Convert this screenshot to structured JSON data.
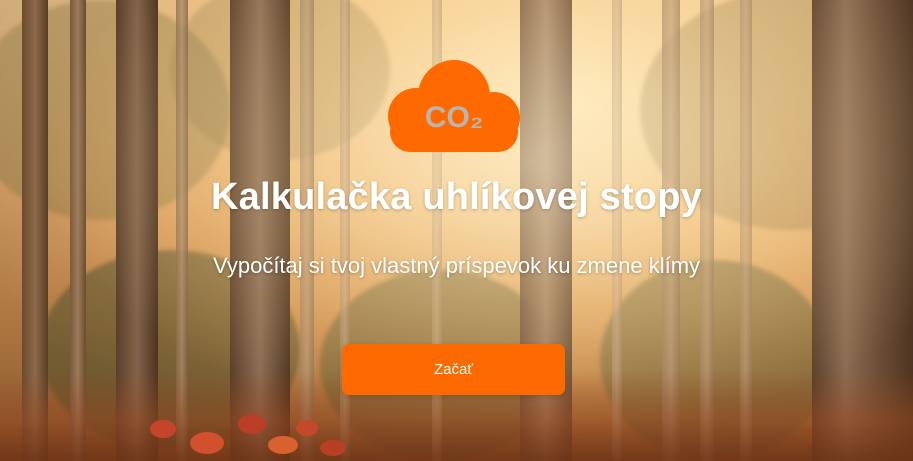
{
  "hero": {
    "background_description": "misty forest",
    "logo_icon": "co2-cloud-icon",
    "logo_text": "CO₂",
    "title": "Kalkulačka uhlíkovej stopy",
    "subtitle": "Vypočítaj si tvoj vlastný príspevok ku zmene klímy",
    "start_label": "Začať"
  },
  "colors": {
    "accent": "#ff6a00",
    "logo_text": "#b9b4ad",
    "text": "#ffffff"
  }
}
